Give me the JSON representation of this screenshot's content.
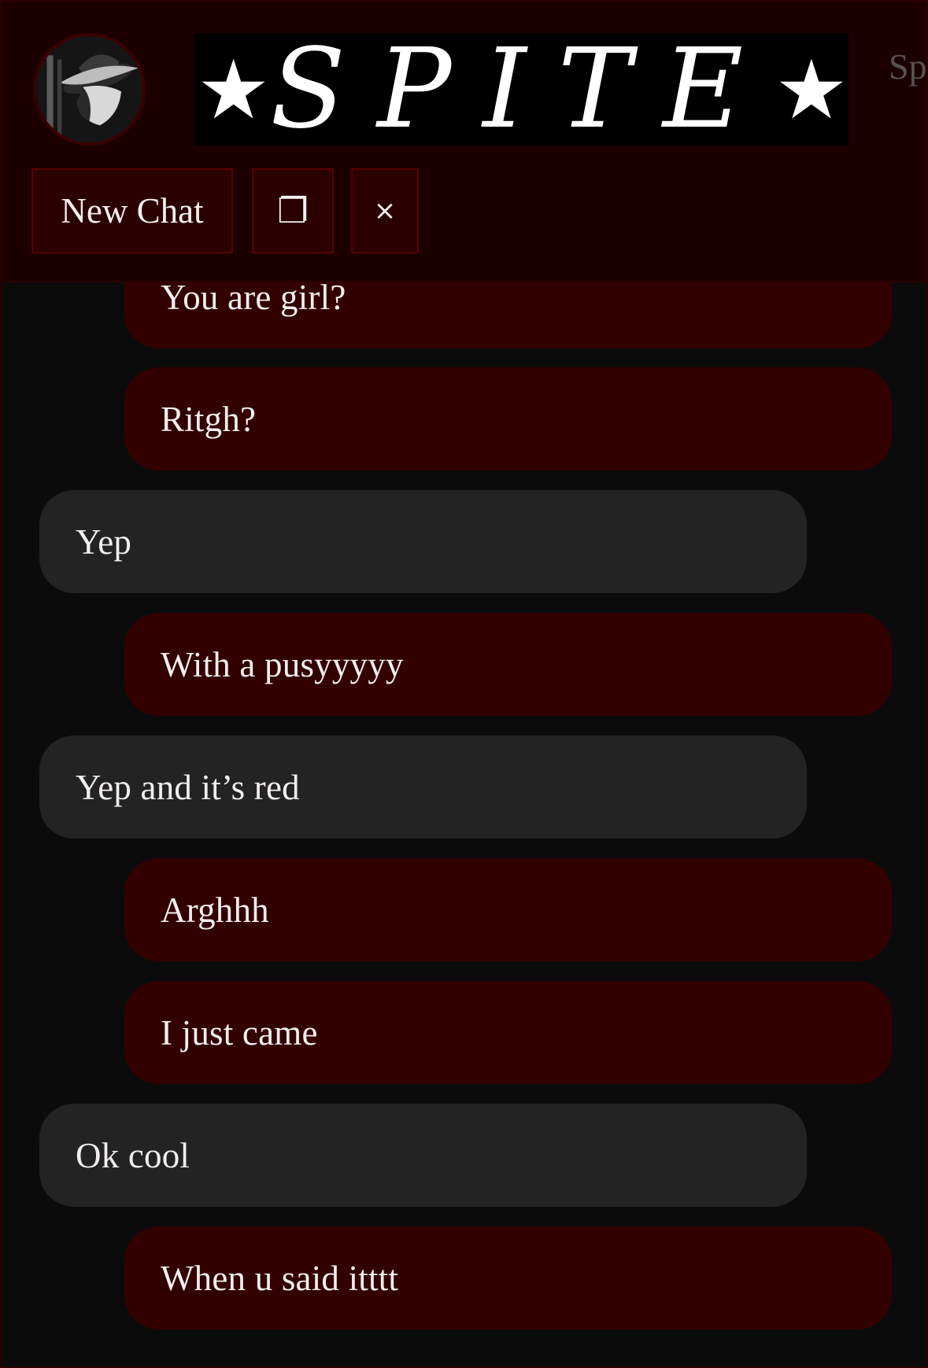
{
  "header": {
    "banner_text": "SPITE",
    "banner_star": "★",
    "side_text": "Sp Ch",
    "new_chat_label": "New Chat",
    "copy_icon": "❐",
    "close_icon": "×"
  },
  "messages": [
    {
      "sender": "me",
      "text": "You are girl?"
    },
    {
      "sender": "me",
      "text": "Ritgh?"
    },
    {
      "sender": "them",
      "text": "Yep"
    },
    {
      "sender": "me",
      "text": "With a pusyyyyy"
    },
    {
      "sender": "them",
      "text": "Yep and it’s red"
    },
    {
      "sender": "me",
      "text": "Arghhh"
    },
    {
      "sender": "me",
      "text": "I just came"
    },
    {
      "sender": "them",
      "text": "Ok cool"
    },
    {
      "sender": "me",
      "text": "When u said itttt"
    }
  ],
  "colors": {
    "background": "#0c0b0b",
    "header_bg": "#1c0000",
    "my_bubble": "#330000",
    "their_bubble": "#232323",
    "button_bg": "#2b0000",
    "button_border": "#5a0000"
  }
}
